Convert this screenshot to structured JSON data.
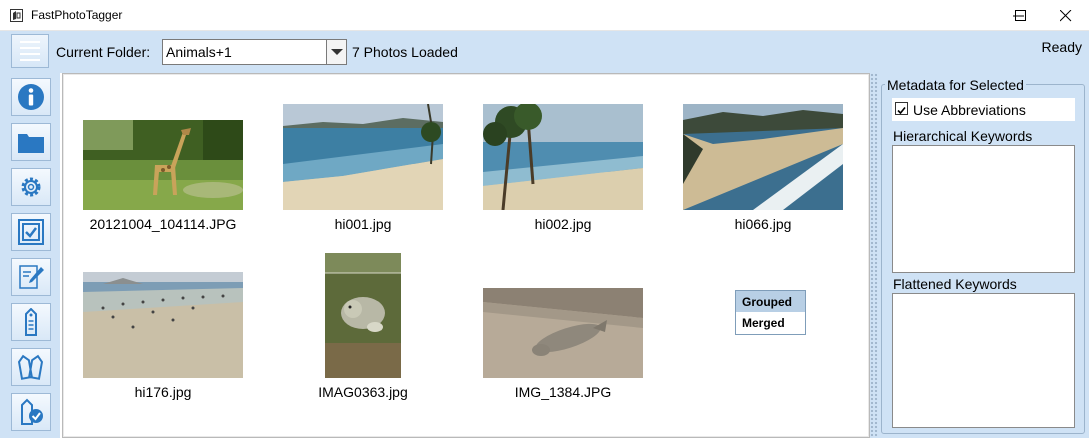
{
  "window": {
    "title": "FastPhotoTagger"
  },
  "toolbar": {
    "current_folder_label": "Current Folder:",
    "current_folder_value": "Animals+1",
    "photos_loaded": "7 Photos Loaded",
    "status": "Ready"
  },
  "sidebar": {
    "buttons": [
      "info-icon",
      "folder-icon",
      "gear-icon",
      "checkbox-icon",
      "edit-icon",
      "tag-icon",
      "tags-icon",
      "tag-check-icon"
    ]
  },
  "gallery": {
    "photos": [
      {
        "name": "20121004_104114.JPG",
        "subject": "giraffe"
      },
      {
        "name": "hi001.jpg",
        "subject": "beach"
      },
      {
        "name": "hi002.jpg",
        "subject": "palm beach"
      },
      {
        "name": "hi066.jpg",
        "subject": "coastline"
      },
      {
        "name": "hi176.jpg",
        "subject": "crowded beach"
      },
      {
        "name": "IMAG0363.jpg",
        "subject": "seal"
      },
      {
        "name": "IMG_1384.JPG",
        "subject": "seal on sand"
      }
    ],
    "group_menu": [
      "Grouped",
      "Merged"
    ],
    "group_selected": "Grouped"
  },
  "metadata": {
    "title": "Metadata for Selected",
    "use_abbreviations_label": "Use Abbreviations",
    "use_abbreviations_checked": true,
    "hierarchical_keywords_label": "Hierarchical Keywords",
    "flattened_keywords_label": "Flattened Keywords"
  },
  "colors": {
    "panel_bg": "#cfe2f5",
    "selected_item": "#b8cfe5",
    "icon_blue": "#2a78c2"
  }
}
